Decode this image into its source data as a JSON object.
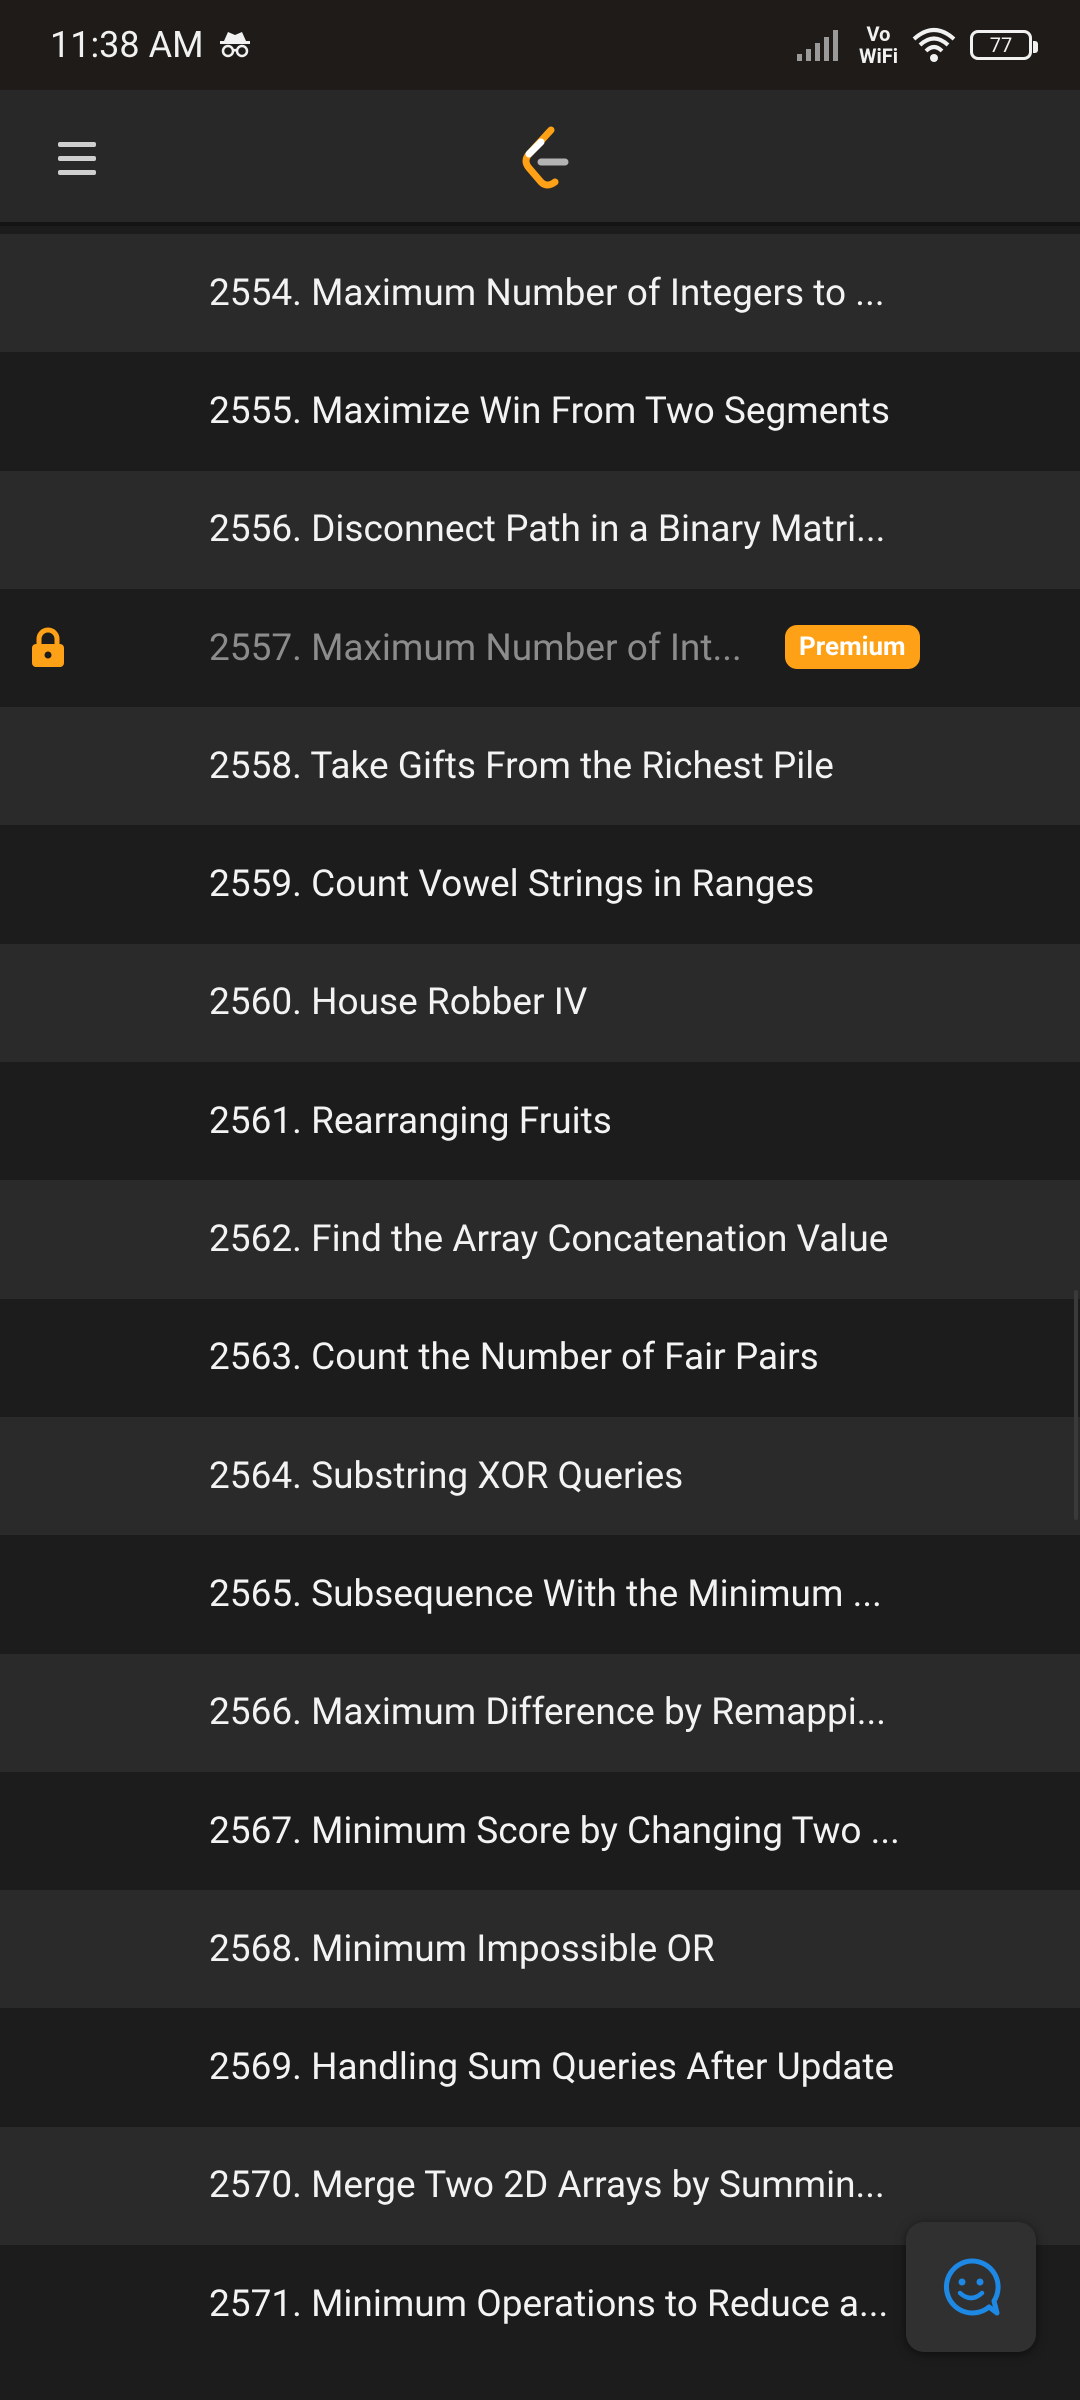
{
  "status_bar": {
    "time": "11:38 AM",
    "volte_top": "Vo",
    "volte_bottom": "WiFi",
    "battery": "77"
  },
  "app_bar": {
    "menu_icon": "hamburger-menu-icon",
    "logo_icon": "leetcode-logo-icon"
  },
  "colors": {
    "accent": "#ffa116",
    "fab_icon": "#1e88e5",
    "row_light": "#2a2a2a",
    "row_dark": "#1c1c1c"
  },
  "problems": [
    {
      "title": "2554. Maximum Number of Integers to ..."
    },
    {
      "title": "2555. Maximize Win From Two Segments"
    },
    {
      "title": "2556. Disconnect Path in a Binary Matri..."
    },
    {
      "title": "2557. Maximum Number of Int...",
      "badge": "Premium"
    },
    {
      "title": "2558. Take Gifts From the Richest Pile"
    },
    {
      "title": "2559. Count Vowel Strings in Ranges"
    },
    {
      "title": "2560. House Robber IV"
    },
    {
      "title": "2561. Rearranging Fruits"
    },
    {
      "title": "2562. Find the Array Concatenation Value"
    },
    {
      "title": "2563. Count the Number of Fair Pairs"
    },
    {
      "title": "2564. Substring XOR Queries"
    },
    {
      "title": "2565. Subsequence With the Minimum ..."
    },
    {
      "title": "2566. Maximum Difference by Remappi..."
    },
    {
      "title": "2567. Minimum Score by Changing Two ..."
    },
    {
      "title": "2568. Minimum Impossible OR"
    },
    {
      "title": "2569. Handling Sum Queries After Update"
    },
    {
      "title": "2570. Merge Two 2D Arrays by Summin..."
    },
    {
      "title": "2571. Minimum Operations to Reduce a..."
    }
  ],
  "fab": {
    "icon": "chat-smiley-icon"
  }
}
